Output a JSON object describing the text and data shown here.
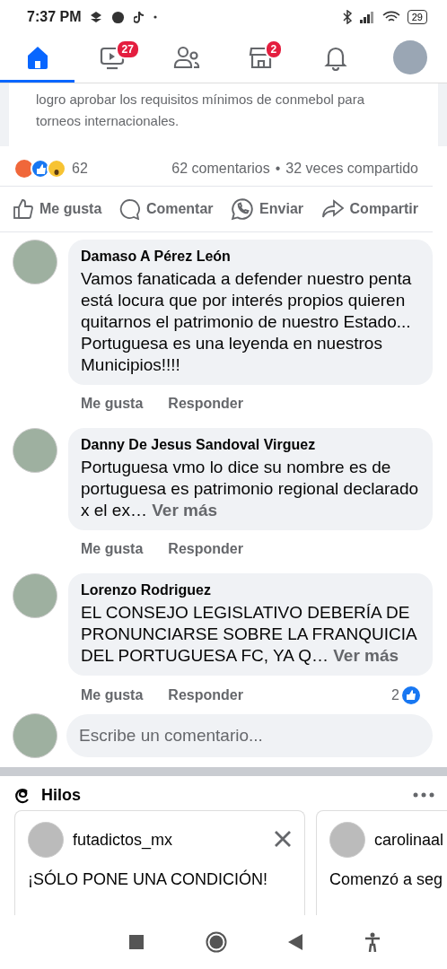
{
  "status_bar": {
    "time": "7:37 PM",
    "battery": "29"
  },
  "nav_tabs": [
    {
      "kind": "home",
      "selected": true
    },
    {
      "kind": "video",
      "selected": false,
      "badge": "27"
    },
    {
      "kind": "friends",
      "selected": false
    },
    {
      "kind": "marketplace",
      "selected": false,
      "badge": "2"
    },
    {
      "kind": "notifications",
      "selected": false
    },
    {
      "kind": "profile",
      "selected": false
    }
  ],
  "post": {
    "text_lines": [
      "logro aprobar los requisitos mínimos de conmebol para",
      "torneos internacionales."
    ],
    "reaction_count": "62",
    "stats_separator": "•",
    "comments_count": "62 comentarios",
    "shares_count": "32 veces compartido",
    "actions": [
      {
        "kind": "like",
        "label": "Me gusta"
      },
      {
        "kind": "comment",
        "label": "Comentar"
      },
      {
        "kind": "send",
        "label": "Enviar"
      },
      {
        "kind": "share",
        "label": "Compartir"
      }
    ]
  },
  "comments": [
    {
      "author": "Damaso A Pérez León",
      "text": "Vamos fanaticada a defender nuestro penta está locura que por interés propios quieren quitarnos el patrimonio de nuestro Estado... Portuguesa es una leyenda en nuestros Municipios!!!!",
      "like_label": "Me gusta",
      "reply_label": "Responder"
    },
    {
      "author": "Danny De Jesus Sandoval Virguez",
      "text": "Portuguesa vmo lo dice su nombre es de portuguesa es patrimonio regional declarado x el ex…",
      "more": "Ver más",
      "like_label": "Me gusta",
      "reply_label": "Responder"
    },
    {
      "author": "Lorenzo Rodriguez",
      "text": "EL CONSEJO LEGISLATIVO DEBERÍA DE PRONUNCIARSE SOBRE LA FRANQUICIA DEL PORTUGUESA FC, YA Q…",
      "more": "Ver más",
      "like_label": "Me gusta",
      "reply_label": "Responder",
      "likes": "2"
    }
  ],
  "composer": {
    "placeholder": "Escribe un comentario..."
  },
  "threads": {
    "title": "Hilos",
    "cards": [
      {
        "user": "futadictos_mx",
        "text": "¡SÓLO PONE UNA CONDICIÓN!",
        "closable": true
      },
      {
        "user": "carolinaal",
        "text": "Comenzó a seg"
      }
    ]
  }
}
